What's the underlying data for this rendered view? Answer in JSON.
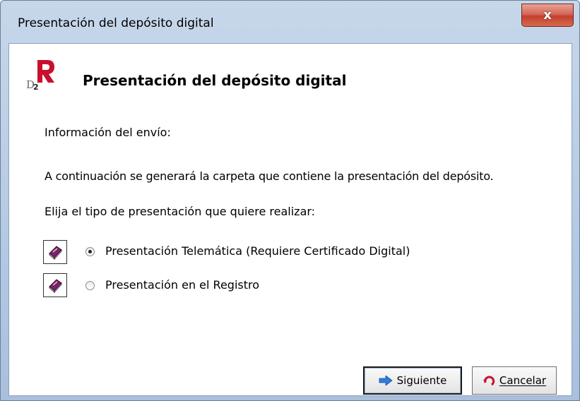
{
  "window": {
    "title": "Presentación del depósito digital",
    "close_glyph": "x"
  },
  "header": {
    "logo": "d2-r-logo",
    "title": "Presentación del depósito digital"
  },
  "content": {
    "info_label": "Información del envío:",
    "continue_text": "A continuación se generará la carpeta que contiene la presentación del depósito.",
    "choose_text": "Elija el tipo de presentación que quiere realizar:"
  },
  "options": [
    {
      "label": "Presentación Telemática (Requiere Certificado Digital)",
      "selected": true,
      "icon": "book-icon"
    },
    {
      "label": "Presentación en el Registro",
      "selected": false,
      "icon": "book-icon"
    }
  ],
  "buttons": {
    "next_label": "Siguiente",
    "next_icon": "arrow-right-icon",
    "cancel_label": "Cancelar",
    "cancel_icon": "undo-icon"
  },
  "colors": {
    "logo_red": "#c8102e",
    "close_red": "#c3402e",
    "book_purple": "#7a1f7a"
  }
}
